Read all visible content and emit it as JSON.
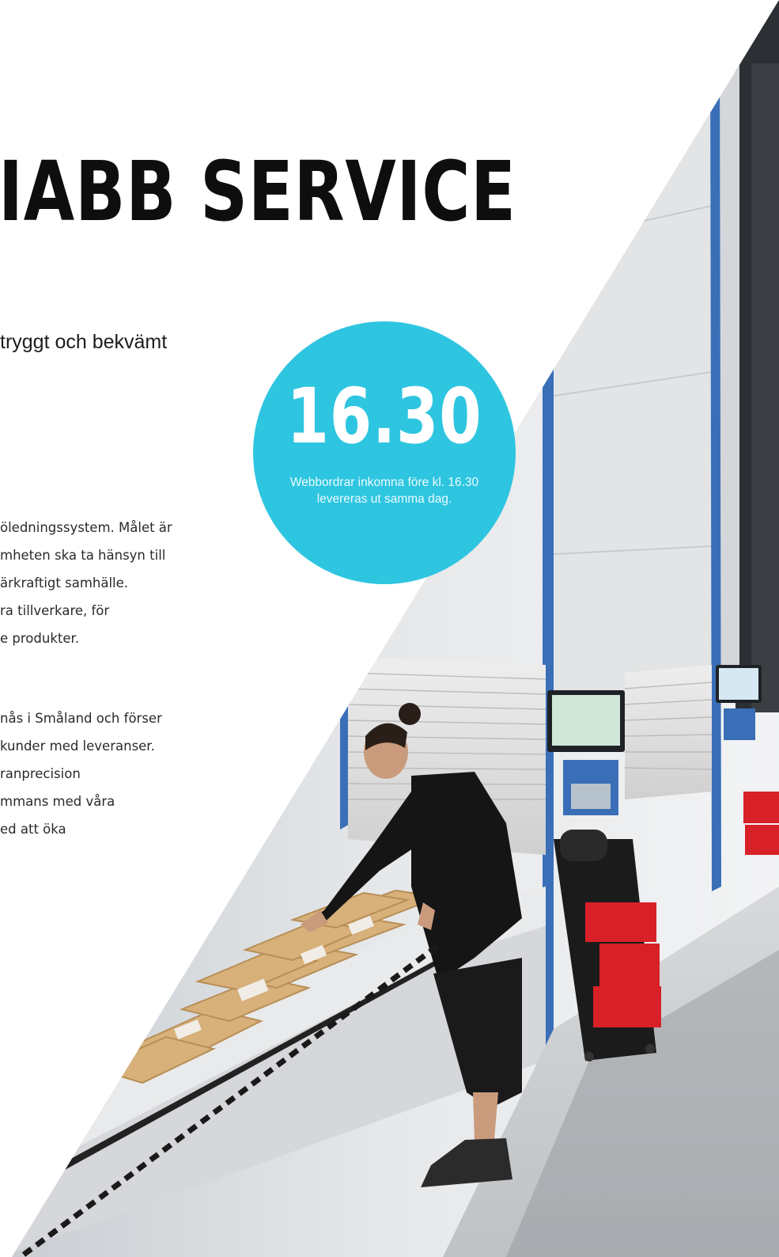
{
  "headline": "IABB SERVICE",
  "lead": "tryggt och bekvämt",
  "body_lines": [
    "öledningssystem. Målet är",
    "mheten ska ta hänsyn till",
    "ärkraftigt samhälle.",
    "ra tillverkare, för",
    "e produkter.",
    "nås i Småland och förser",
    "kunder med leveranser.",
    "ranprecision",
    "mmans med våra",
    "ed att öka"
  ],
  "badge": {
    "number": "16.30",
    "text": "Webbordrar inkomna före kl. 16.30 levereras ut samma dag."
  },
  "colors": {
    "accent": "#2ec5e0",
    "headline": "#0e0e0e",
    "machine_blue": "#3a6fb8",
    "crate_red": "#d82028"
  },
  "photo": {
    "description": "warehouse-vertical-lift-worker-photo"
  }
}
